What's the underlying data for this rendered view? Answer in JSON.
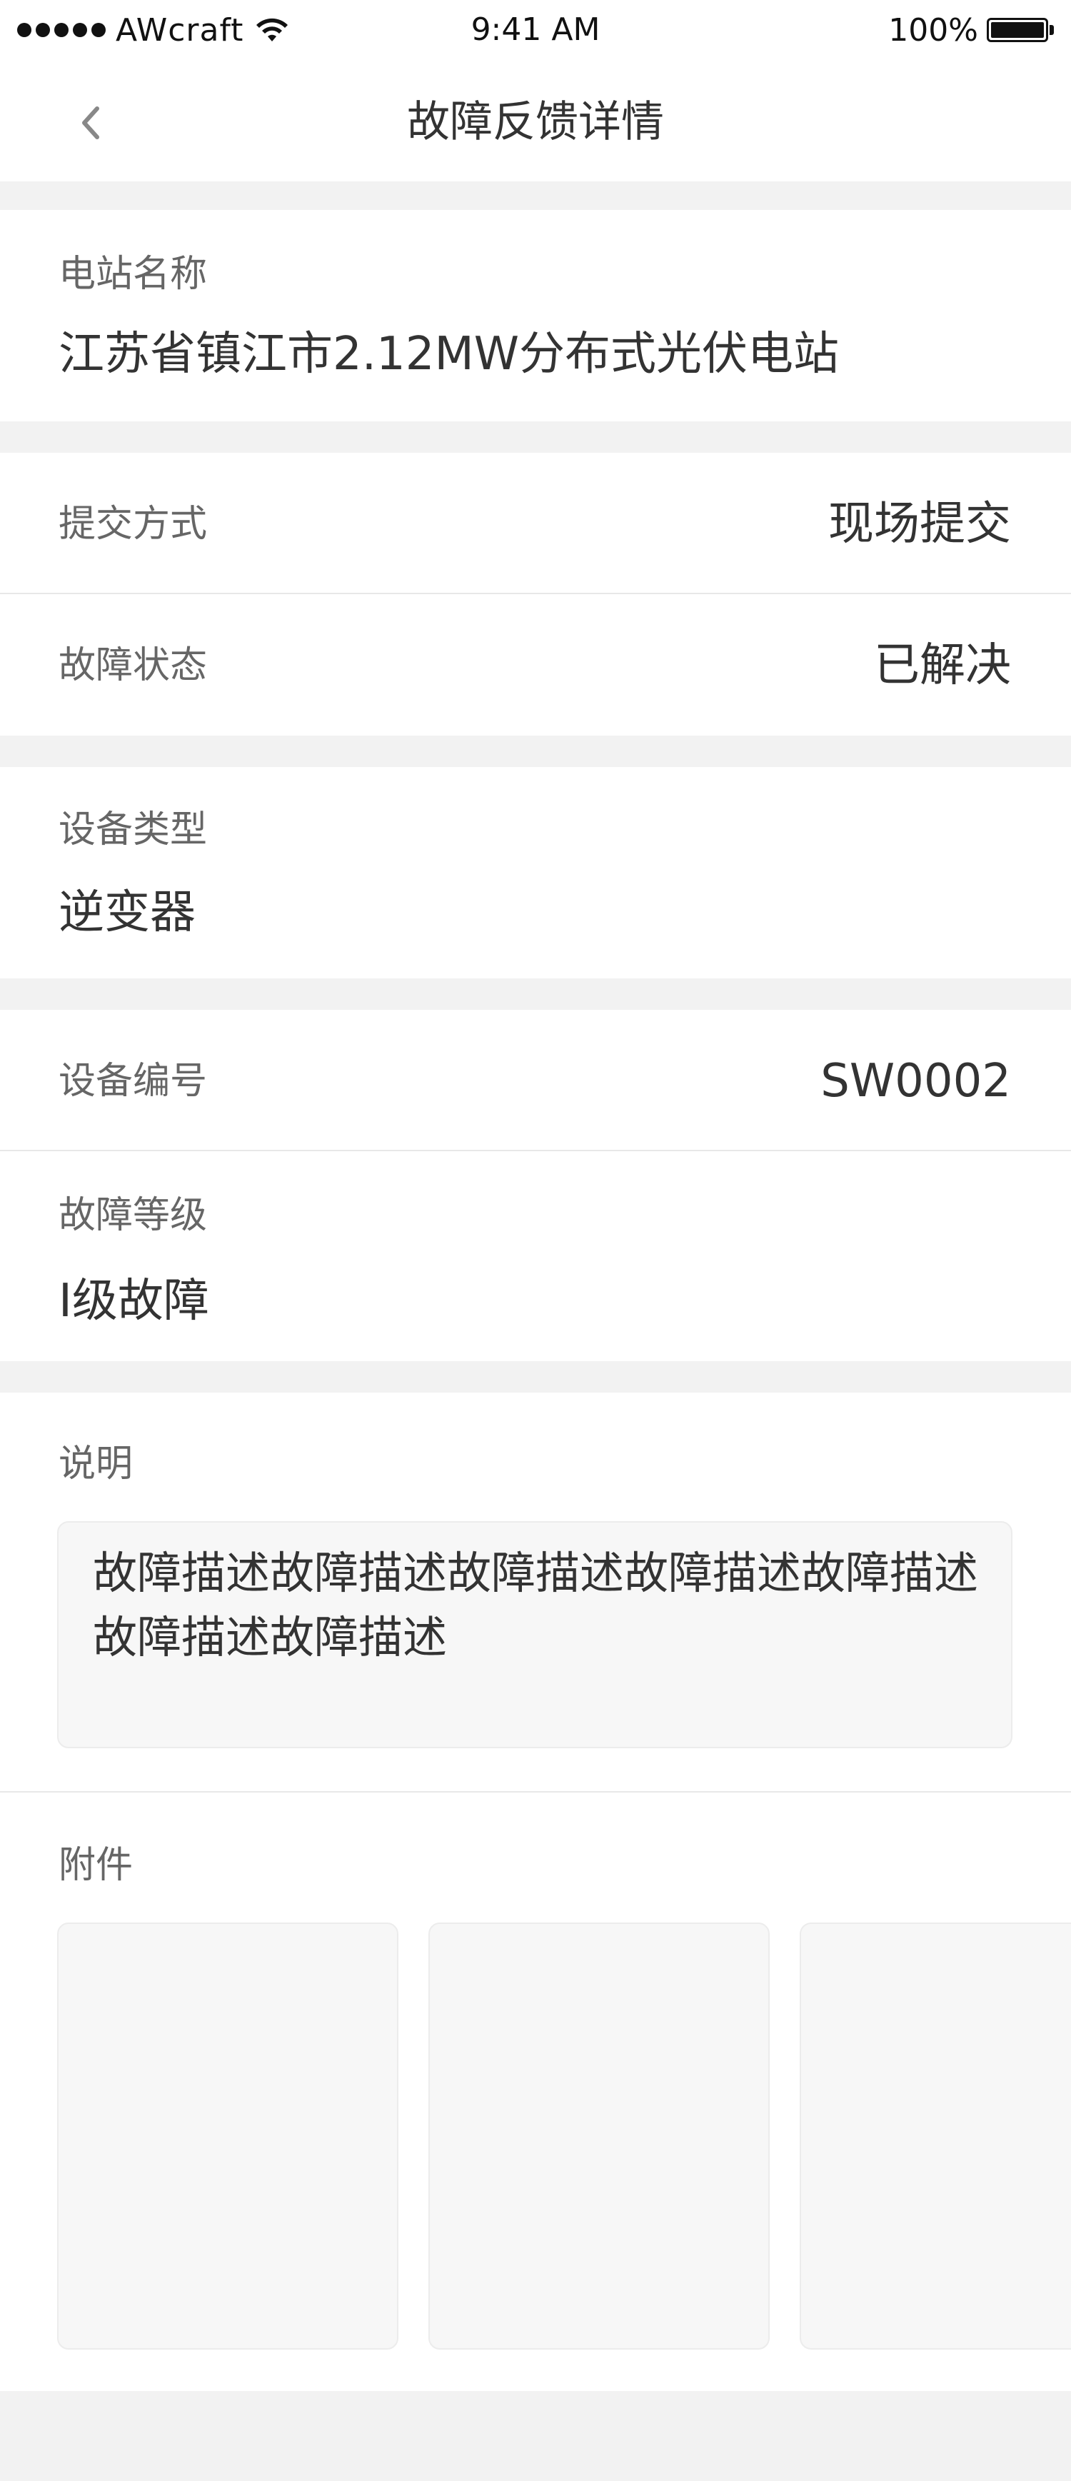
{
  "status_bar": {
    "carrier": "AWcraft",
    "time": "9:41 AM",
    "battery": "100%"
  },
  "nav": {
    "title": "故障反馈详情",
    "back_icon": "chevron-left-icon"
  },
  "station": {
    "label": "电站名称",
    "value": "江苏省镇江市2.12MW分布式光伏电站"
  },
  "submit_method": {
    "label": "提交方式",
    "value": "现场提交"
  },
  "fault_status": {
    "label": "故障状态",
    "value": "已解决"
  },
  "device_type": {
    "label": "设备类型",
    "value": "逆变器"
  },
  "device_no": {
    "label": "设备编号",
    "value": "SW0002"
  },
  "fault_level": {
    "label": "故障等级",
    "value": "I级故障"
  },
  "description": {
    "label": "说明",
    "text": "故障描述故障描述故障描述故障描述故障描述故障描述故障描述"
  },
  "attachments": {
    "label": "附件"
  },
  "colors": {
    "background": "#f2f2f2",
    "card": "#ffffff",
    "label": "#666666",
    "value": "#333333"
  }
}
